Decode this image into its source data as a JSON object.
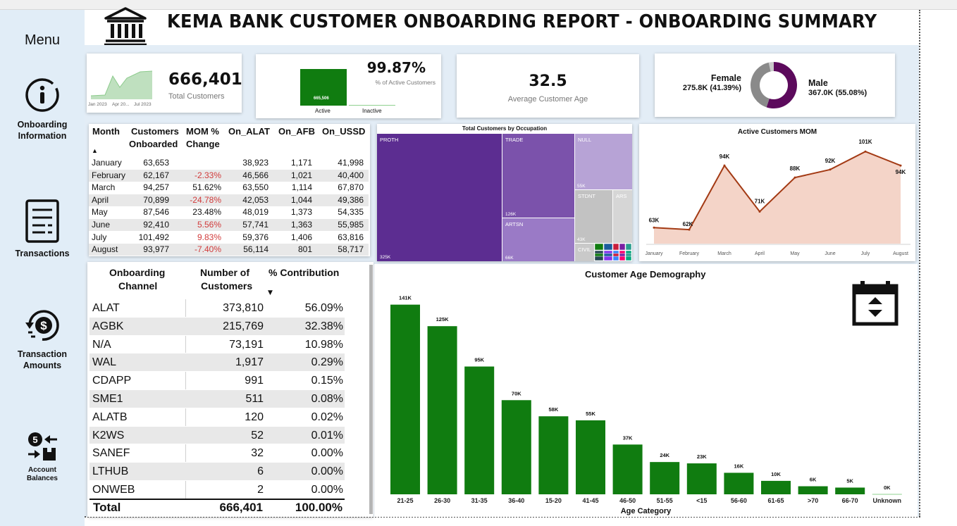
{
  "title": "KEMA BANK CUSTOMER ONBOARDING REPORT - ONBOARDING SUMMARY",
  "sidebar": {
    "menu_label": "Menu",
    "items": [
      {
        "label_line1": "Onboarding",
        "label_line2": "Information",
        "icon": "info-icon"
      },
      {
        "label_line1": "Transactions",
        "label_line2": "",
        "icon": "document-icon"
      },
      {
        "label_line1": "Transaction",
        "label_line2": "Amounts",
        "icon": "dollar-refresh-icon"
      },
      {
        "label_line1": "Account",
        "label_line2": "Balances",
        "icon": "transfer-icon"
      }
    ]
  },
  "kpis": {
    "total_customers": {
      "value": "666,401",
      "label": "Total Customers",
      "spark_labels": [
        "Jan 2023",
        "Apr 20...",
        "Jul 2023"
      ]
    },
    "active": {
      "value": "99.87%",
      "label": "% of Active Customers",
      "bar_value_label": "665,506",
      "active_label": "Active",
      "inactive_label": "Inactive",
      "active_fraction": 0.9987
    },
    "avg_age": {
      "value": "32.5",
      "label": "Average Customer Age"
    },
    "gender": {
      "female_label": "Female",
      "female_value": "275.8K (41.39%)",
      "male_label": "Male",
      "male_value": "367.0K (55.08%)"
    }
  },
  "month_table": {
    "headers": [
      "Month",
      "Customers Onboarded",
      "MOM % Change",
      "On_ALAT",
      "On_AFB",
      "On_USSD"
    ],
    "header_line1": [
      "Month",
      "Customers",
      "MOM %",
      "On_ALAT",
      "On_AFB",
      "On_USSD"
    ],
    "header_line2": [
      "",
      "Onboarded",
      "Change",
      "",
      "",
      ""
    ],
    "sort_arrow": "▲",
    "rows": [
      {
        "month": "January",
        "onboarded": "63,653",
        "mom": "",
        "alat": "38,923",
        "afb": "1,171",
        "ussd": "41,998",
        "neg": false
      },
      {
        "month": "February",
        "onboarded": "62,167",
        "mom": "-2.33%",
        "alat": "46,566",
        "afb": "1,021",
        "ussd": "40,400",
        "neg": true
      },
      {
        "month": "March",
        "onboarded": "94,257",
        "mom": "51.62%",
        "alat": "63,550",
        "afb": "1,114",
        "ussd": "67,870",
        "neg": false
      },
      {
        "month": "April",
        "onboarded": "70,899",
        "mom": "-24.78%",
        "alat": "42,053",
        "afb": "1,044",
        "ussd": "49,386",
        "neg": true
      },
      {
        "month": "May",
        "onboarded": "87,546",
        "mom": "23.48%",
        "alat": "48,019",
        "afb": "1,373",
        "ussd": "54,335",
        "neg": false
      },
      {
        "month": "June",
        "onboarded": "92,410",
        "mom": "5.56%",
        "alat": "57,741",
        "afb": "1,363",
        "ussd": "55,985",
        "neg": true
      },
      {
        "month": "July",
        "onboarded": "101,492",
        "mom": "9.83%",
        "alat": "59,376",
        "afb": "1,406",
        "ussd": "63,816",
        "neg": true
      },
      {
        "month": "August",
        "onboarded": "93,977",
        "mom": "-7.40%",
        "alat": "56,114",
        "afb": "801",
        "ussd": "58,717",
        "neg": true
      }
    ]
  },
  "treemap": {
    "title": "Total Customers by Occupation",
    "cells": [
      {
        "name": "PROTH",
        "value": "325K",
        "color": "#5c2d91"
      },
      {
        "name": "TRADE",
        "value": "126K",
        "color": "#7b52ab"
      },
      {
        "name": "ARTSN",
        "value": "66K",
        "color": "#9a7ac6"
      },
      {
        "name": "NULL",
        "value": "55K",
        "color": "#b7a3d6"
      },
      {
        "name": "STDNT",
        "value": "43K",
        "color": "#c2c2c2"
      },
      {
        "name": "ARS",
        "value": "",
        "color": "#d6d6d6"
      },
      {
        "name": "CIVIL",
        "value": "",
        "color": "#c9c9c9"
      }
    ]
  },
  "channel_table": {
    "header_line1": [
      "Onboarding",
      "Number of",
      "% Contribution"
    ],
    "header_line2": [
      "Channel",
      "Customers",
      ""
    ],
    "sort_arrow": "▼",
    "rows": [
      {
        "channel": "ALAT",
        "count": "373,810",
        "pct": "56.09%"
      },
      {
        "channel": "AGBK",
        "count": "215,769",
        "pct": "32.38%"
      },
      {
        "channel": "N/A",
        "count": "73,191",
        "pct": "10.98%"
      },
      {
        "channel": "WAL",
        "count": "1,917",
        "pct": "0.29%"
      },
      {
        "channel": "CDAPP",
        "count": "991",
        "pct": "0.15%"
      },
      {
        "channel": "SME1",
        "count": "511",
        "pct": "0.08%"
      },
      {
        "channel": "ALATB",
        "count": "120",
        "pct": "0.02%"
      },
      {
        "channel": "K2WS",
        "count": "52",
        "pct": "0.01%"
      },
      {
        "channel": "SANEF",
        "count": "32",
        "pct": "0.00%"
      },
      {
        "channel": "LTHUB",
        "count": "6",
        "pct": "0.00%"
      },
      {
        "channel": "ONWEB",
        "count": "2",
        "pct": "0.00%"
      }
    ],
    "total": {
      "label": "Total",
      "count": "666,401",
      "pct": "100.00%"
    }
  },
  "chart_data": [
    {
      "type": "area",
      "title": "Active Customers MOM",
      "categories": [
        "January",
        "February",
        "March",
        "April",
        "May",
        "June",
        "July",
        "August"
      ],
      "values": [
        63,
        62,
        94,
        71,
        88,
        92,
        101,
        94
      ],
      "data_labels": [
        "63K",
        "62K",
        "94K",
        "71K",
        "88K",
        "92K",
        "101K",
        "94K"
      ],
      "ylim": [
        55,
        106
      ],
      "line_color": "#a33a14",
      "fill_color": "#f4d4c8"
    },
    {
      "type": "bar",
      "title": "Customer Age Demography",
      "xlabel": "Age Category",
      "categories": [
        "21-25",
        "26-30",
        "31-35",
        "36-40",
        "15-20",
        "41-45",
        "46-50",
        "51-55",
        "<15",
        "56-60",
        "61-65",
        ">70",
        "66-70",
        "Unknown"
      ],
      "values": [
        141,
        125,
        95,
        70,
        58,
        55,
        37,
        24,
        23,
        16,
        10,
        6,
        5,
        0
      ],
      "data_labels": [
        "141K",
        "125K",
        "95K",
        "70K",
        "58K",
        "55K",
        "37K",
        "24K",
        "23K",
        "16K",
        "10K",
        "6K",
        "5K",
        "0K"
      ],
      "ylim": [
        0,
        145
      ],
      "bar_color": "#107c10"
    }
  ],
  "colors": {
    "green": "#107c10",
    "purple": "#5c2d91",
    "gray": "#8a8a8a",
    "sidebar": "#e1edf7"
  }
}
